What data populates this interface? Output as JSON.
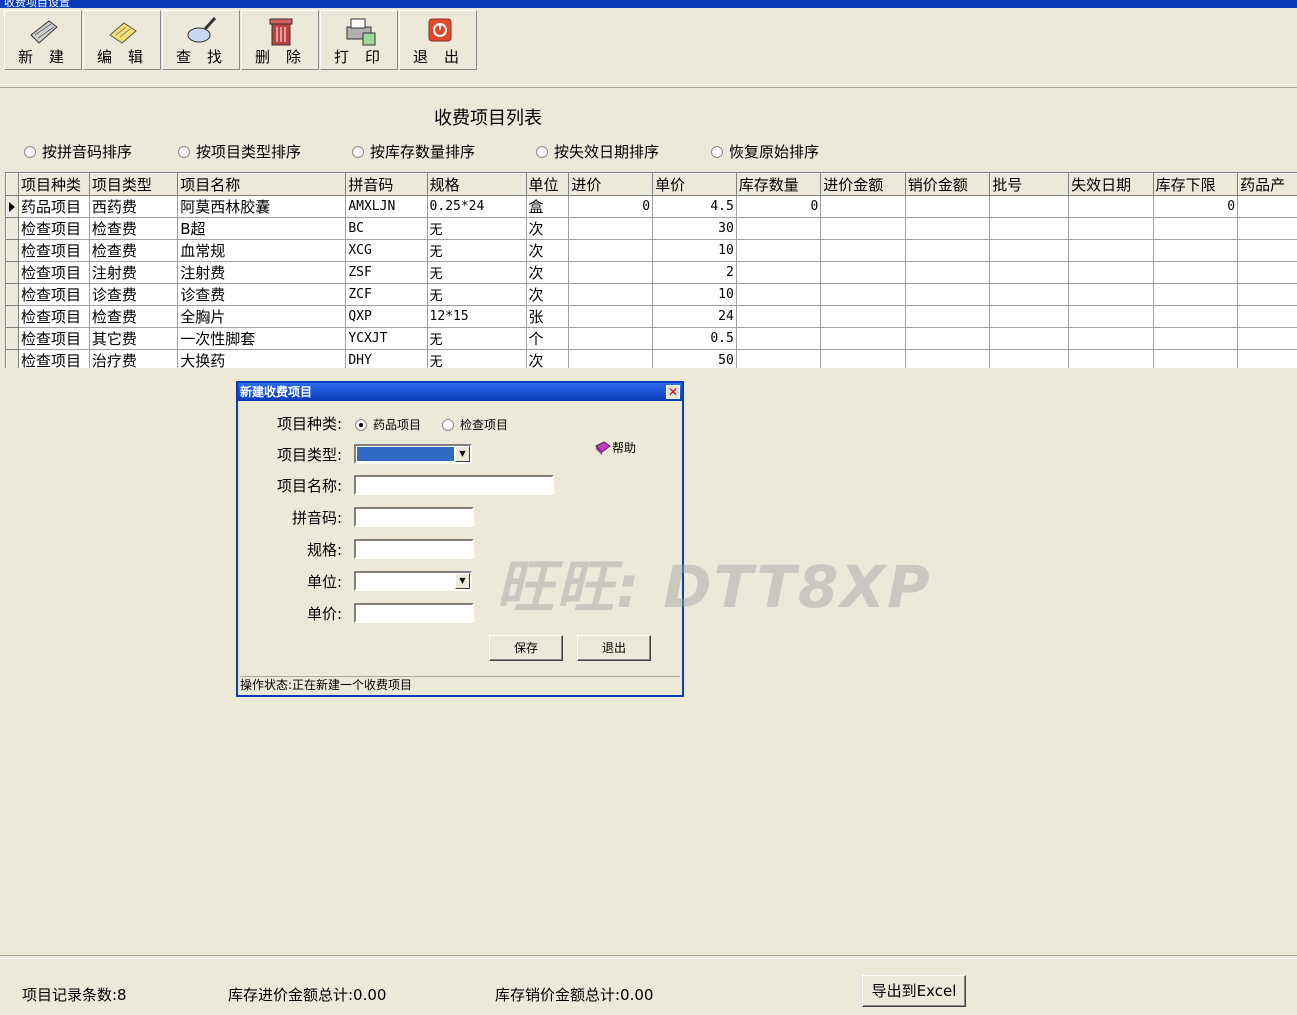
{
  "window": {
    "title": "收费项目设置"
  },
  "toolbar": [
    {
      "label": "新建",
      "icon": "new-icon"
    },
    {
      "label": "编辑",
      "icon": "edit-icon"
    },
    {
      "label": "查找",
      "icon": "search-icon"
    },
    {
      "label": "删除",
      "icon": "delete-icon"
    },
    {
      "label": "打印",
      "icon": "print-icon"
    },
    {
      "label": "退出",
      "icon": "exit-icon"
    }
  ],
  "list_title": "收费项目列表",
  "sort_options": [
    "按拼音码排序",
    "按项目类型排序",
    "按库存数量排序",
    "按失效日期排序",
    "恢复原始排序"
  ],
  "grid": {
    "columns": [
      "项目种类",
      "项目类型",
      "项目名称",
      "拼音码",
      "规格",
      "单位",
      "进价",
      "单价",
      "库存数量",
      "进价金额",
      "销价金额",
      "批号",
      "失效日期",
      "库存下限",
      "药品产"
    ],
    "rows": [
      [
        "药品项目",
        "西药费",
        "阿莫西林胶囊",
        "AMXLJN",
        "0.25*24",
        "盒",
        "0",
        "4.5",
        "0",
        "",
        "",
        "",
        "",
        "0",
        ""
      ],
      [
        "检查项目",
        "检查费",
        "B超",
        "BC",
        "无",
        "次",
        "",
        "30",
        "",
        "",
        "",
        "",
        "",
        "",
        ""
      ],
      [
        "检查项目",
        "检查费",
        "血常规",
        "XCG",
        "无",
        "次",
        "",
        "10",
        "",
        "",
        "",
        "",
        "",
        "",
        ""
      ],
      [
        "检查项目",
        "注射费",
        "注射费",
        "ZSF",
        "无",
        "次",
        "",
        "2",
        "",
        "",
        "",
        "",
        "",
        "",
        ""
      ],
      [
        "检查项目",
        "诊查费",
        "诊查费",
        "ZCF",
        "无",
        "次",
        "",
        "10",
        "",
        "",
        "",
        "",
        "",
        "",
        ""
      ],
      [
        "检查项目",
        "检查费",
        "全胸片",
        "QXP",
        "12*15",
        "张",
        "",
        "24",
        "",
        "",
        "",
        "",
        "",
        "",
        ""
      ],
      [
        "检查项目",
        "其它费",
        "一次性脚套",
        "YCXJT",
        "无",
        "个",
        "",
        "0.5",
        "",
        "",
        "",
        "",
        "",
        "",
        ""
      ],
      [
        "检查项目",
        "治疗费",
        "大换药",
        "DHY",
        "无",
        "次",
        "",
        "50",
        "",
        "",
        "",
        "",
        "",
        "",
        ""
      ]
    ]
  },
  "dialog": {
    "title": "新建收费项目",
    "kind_label": "项目种类:",
    "kind_options": [
      "药品项目",
      "检查项目"
    ],
    "type_label": "项目类型:",
    "name_label": "项目名称:",
    "pinyin_label": "拼音码:",
    "spec_label": "规格:",
    "unit_label": "单位:",
    "price_label": "单价:",
    "help_label": "帮助",
    "save_label": "保存",
    "exit_label": "退出",
    "status_text": "操作状态:正在新建一个收费项目"
  },
  "watermark": "旺旺: DTT8XP",
  "footer": {
    "record_count": "项目记录条数:8",
    "cost_total": "库存进价金额总计:0.00",
    "sale_total": "库存销价金额总计:0.00",
    "export_label": "导出到Excel"
  }
}
